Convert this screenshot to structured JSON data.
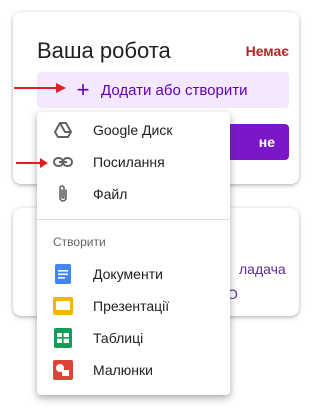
{
  "card": {
    "title": "Ваша робота",
    "status": "Немає",
    "add_button_label": "Додати або створити",
    "submit_button_label": "не",
    "bottom_text": "ладача",
    "bottom_glyph": "О"
  },
  "menu": {
    "items": [
      {
        "label": "Google Диск",
        "icon": "google-drive-icon"
      },
      {
        "label": "Посилання",
        "icon": "link-icon"
      },
      {
        "label": "Файл",
        "icon": "paperclip-icon"
      }
    ],
    "section_label": "Створити",
    "create_items": [
      {
        "label": "Документи",
        "icon": "docs-icon"
      },
      {
        "label": "Презентації",
        "icon": "slides-icon"
      },
      {
        "label": "Таблиці",
        "icon": "sheets-icon"
      },
      {
        "label": "Малюнки",
        "icon": "drawings-icon"
      }
    ]
  },
  "colors": {
    "accent": "#6200b3",
    "accent_bg": "#f3e8fd",
    "status_red": "#b3261e",
    "arrow_red": "#e02020",
    "docs_blue": "#4285f4",
    "slides_yellow": "#f4b400",
    "sheets_green": "#0f9d58",
    "drawings_red": "#db4437"
  }
}
